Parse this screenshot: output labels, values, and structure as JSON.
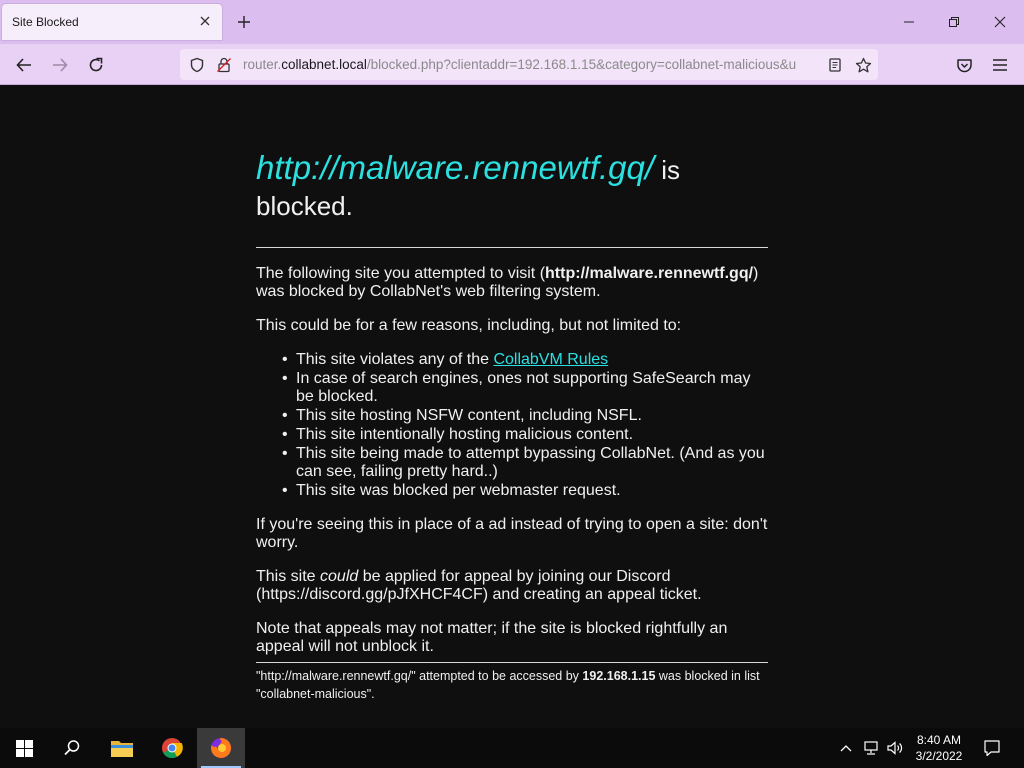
{
  "browser": {
    "tab": {
      "title": "Site Blocked"
    },
    "address_bar": {
      "url_prefix": "router.",
      "url_host": "collabnet.local",
      "url_rest": "/blocked.php?clientaddr=192.168.1.15&category=collabnet-malicious&u"
    }
  },
  "page": {
    "headline": {
      "url": "http://malware.rennewtf.gq/",
      "suffix": " is blocked."
    },
    "intro": {
      "before": "The following site you attempted to visit (",
      "url": "http://malware.rennewtf.gq/",
      "after": ") was blocked by CollabNet's web filtering system."
    },
    "reasons_intro": "This could be for a few reasons, including, but not limited to:",
    "reasons": {
      "r1_before": "This site violates any of the ",
      "r1_link": "CollabVM Rules",
      "r2": "In case of search engines, ones not supporting SafeSearch may be blocked.",
      "r3": "This site hosting NSFW content, including NSFL.",
      "r4": "This site intentionally hosting malicious content.",
      "r5": "This site being made to attempt bypassing CollabNet. (And as you can see, failing pretty hard..)",
      "r6": "This site was blocked per webmaster request."
    },
    "ad_note": "If you're seeing this in place of a ad instead of trying to open a site: don't worry.",
    "appeal": {
      "before": "This site ",
      "emph": "could",
      "after": " be applied for appeal by joining our Discord (https://discord.gg/pJfXHCF4CF) and creating an appeal ticket."
    },
    "appeal_note": "Note that appeals may not matter; if the site is blocked rightfully an appeal will not unblock it.",
    "footer": {
      "before": "\"http://malware.rennewtf.gq/\" attempted to be accessed by ",
      "ip": "192.168.1.15",
      "after": " was blocked in list \"collabnet-malicious\"."
    }
  },
  "taskbar": {
    "clock_time": "8:40 AM",
    "clock_date": "3/2/2022"
  },
  "colors": {
    "tabbar": "#dcbdf0",
    "navbar": "#e9d1f5",
    "page_bg": "#0f0f10",
    "link": "#2ce0e0"
  }
}
